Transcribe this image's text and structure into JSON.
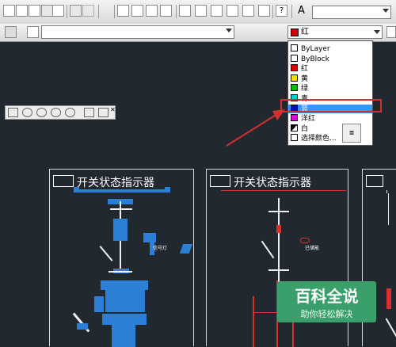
{
  "toolbar": {
    "layer_combo_value": "",
    "text_style_combo_value": "",
    "color_combo_value": "红",
    "color_swatch": "#cc0000"
  },
  "color_dropdown": {
    "items": [
      {
        "label": "ByLayer",
        "color": "#ffffff"
      },
      {
        "label": "ByBlock",
        "color": "#ffffff"
      },
      {
        "label": "红",
        "color": "#e00000"
      },
      {
        "label": "黄",
        "color": "#f0e000"
      },
      {
        "label": "绿",
        "color": "#00c000"
      },
      {
        "label": "青",
        "color": "#00d0d0"
      },
      {
        "label": "蓝",
        "color": "#0010c0"
      },
      {
        "label": "洋红",
        "color": "#e000e0"
      },
      {
        "label": "白",
        "color": "#ffffff"
      },
      {
        "label": "选择颜色...",
        "color": "#ffffff"
      }
    ],
    "selected_index": 6,
    "highlight_color": "#3399ff",
    "annotation_color": "#d03030"
  },
  "panels": [
    {
      "title": "开关状态指示器"
    },
    {
      "title": "开关状态指示器"
    }
  ],
  "drawing_labels": {
    "label_a": "信号灯",
    "label_b": "已储能"
  },
  "watermark": {
    "title": "百科全说",
    "subtitle": "助你轻松解决"
  }
}
